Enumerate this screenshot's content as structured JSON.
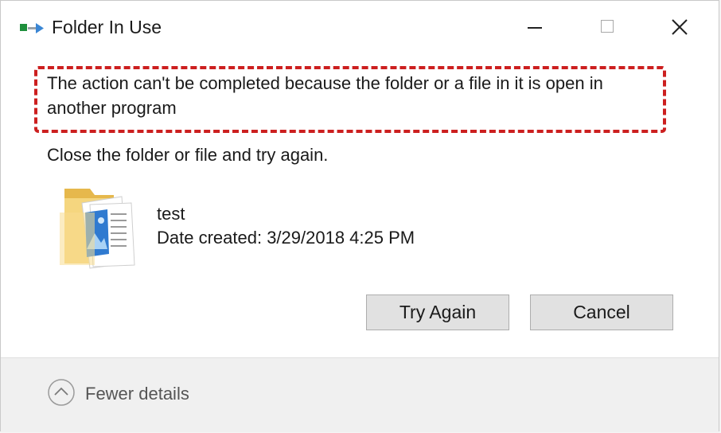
{
  "window": {
    "title": "Folder In Use",
    "controls": {
      "minimize": "minimize-icon",
      "maximize": "maximize-icon",
      "close": "close-icon"
    }
  },
  "main": {
    "message": "The action can't be completed because the folder or a file in it is open in another program",
    "instruction": "Close the folder or file and try again.",
    "file": {
      "icon": "folder-icon",
      "name": "test",
      "date_created": "Date created: 3/29/2018 4:25 PM"
    }
  },
  "buttons": {
    "try_again": "Try Again",
    "cancel": "Cancel"
  },
  "footer": {
    "details_icon": "chevron-up-circle-icon",
    "details_label": "Fewer details"
  },
  "colors": {
    "highlight_border": "#cc1f1f",
    "button_bg": "#e1e1e1",
    "footer_bg": "#f0f0f0",
    "folder_yellow": "#f3d179",
    "file_blue": "#2f7ad0"
  }
}
